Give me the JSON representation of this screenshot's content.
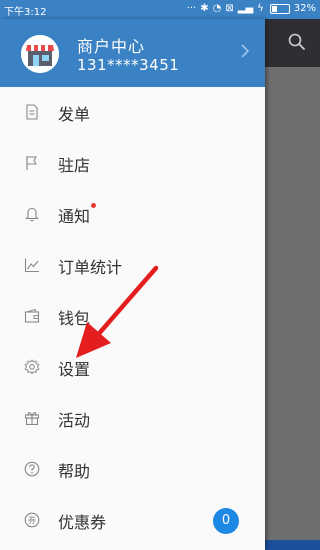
{
  "status": {
    "time": "下午3:12",
    "battery": "32%"
  },
  "header": {
    "title": "商户中心",
    "phone": "131****3451"
  },
  "menu": [
    {
      "label": "发单",
      "icon": "document-icon"
    },
    {
      "label": "驻店",
      "icon": "flag-icon"
    },
    {
      "label": "通知",
      "icon": "bell-icon"
    },
    {
      "label": "订单统计",
      "icon": "line-chart-icon"
    },
    {
      "label": "钱包",
      "icon": "wallet-icon"
    },
    {
      "label": "设置",
      "icon": "gear-icon"
    },
    {
      "label": "活动",
      "icon": "gift-icon"
    },
    {
      "label": "帮助",
      "icon": "help-icon"
    },
    {
      "label": "优惠券",
      "icon": "coupon-icon"
    }
  ],
  "coupon_count": "0",
  "colors": {
    "primary": "#3a82c4",
    "badge": "#1e88e5",
    "arrow": "#e41e1e",
    "dot": "#e53935"
  }
}
